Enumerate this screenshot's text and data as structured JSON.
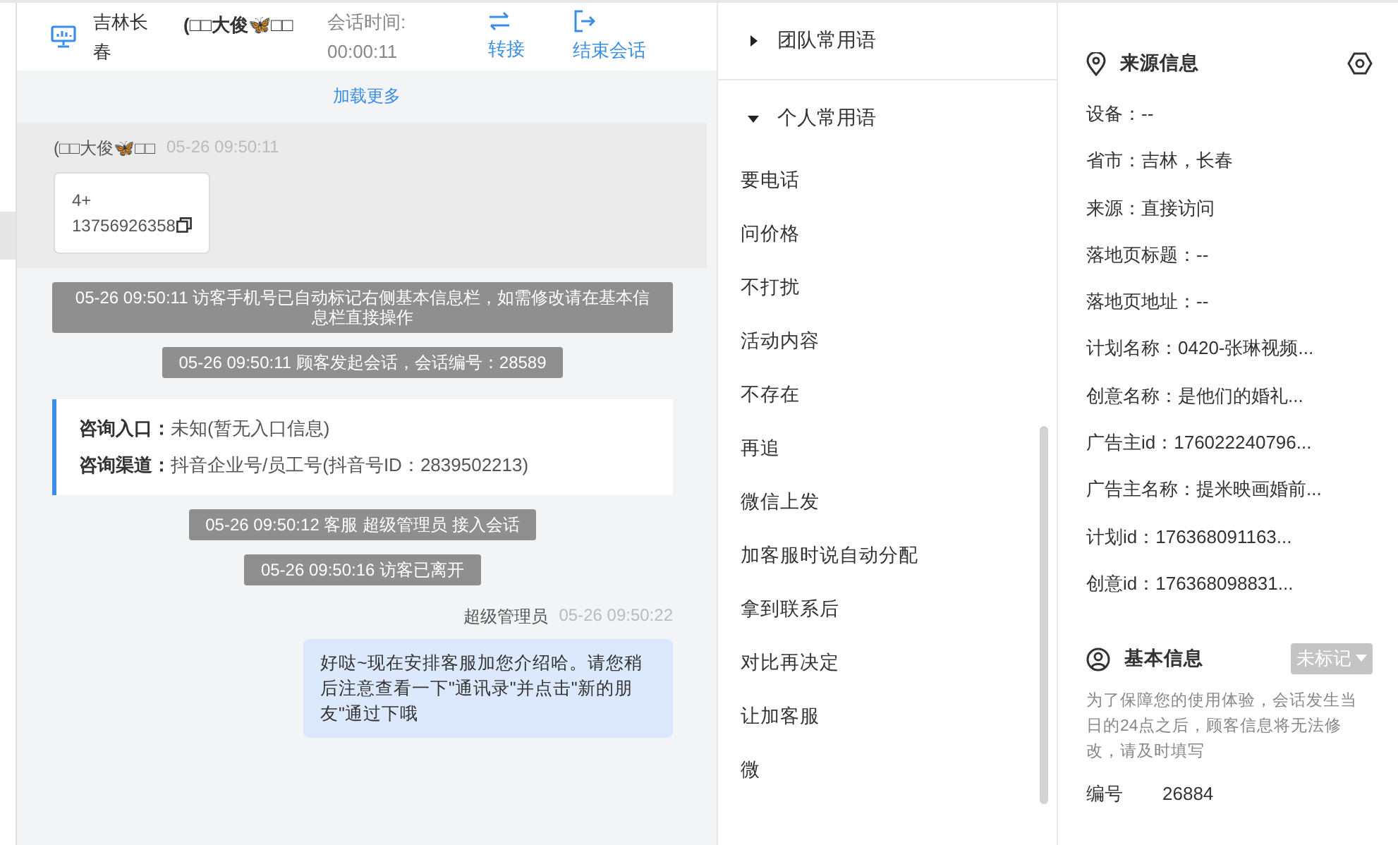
{
  "header": {
    "location": "吉林长春",
    "visitor_name": "(□□大俊🦋□□",
    "timer_label": "会话时间:",
    "timer": "00:00:11",
    "actions": [
      {
        "kind": "transfer",
        "label": "转接"
      },
      {
        "kind": "end",
        "label": "结束会话"
      }
    ]
  },
  "load_more": "加载更多",
  "messages": [
    {
      "kind": "visitor",
      "sender": "(□□大俊🦋□□",
      "time": "05-26 09:50:11",
      "lines": [
        "4+",
        "13756926358"
      ]
    },
    {
      "kind": "system",
      "text": "05-26 09:50:11 访客手机号已自动标记右侧基本信息栏，如需修改请在基本信息栏直接操作"
    },
    {
      "kind": "system",
      "text": "05-26 09:50:11 顾客发起会话，会话编号：28589"
    },
    {
      "kind": "entry",
      "rows": [
        {
          "label": "咨询入口：",
          "value": "未知(暂无入口信息)"
        },
        {
          "label": "咨询渠道：",
          "value": "抖音企业号/员工号(抖音号ID：2839502213)"
        }
      ]
    },
    {
      "kind": "system",
      "text": "05-26 09:50:12 客服 超级管理员 接入会话"
    },
    {
      "kind": "system",
      "text": "05-26 09:50:16 访客已离开"
    },
    {
      "kind": "agent",
      "sender": "超级管理员",
      "time": "05-26 09:50:22",
      "text": "好哒~现在安排客服加您介绍哈。请您稍后注意查看一下\"通讯录\"并点击\"新的朋友\"通过下哦"
    }
  ],
  "phrases": [
    {
      "title": "团队常用语",
      "expanded": false
    },
    {
      "title": "个人常用语",
      "expanded": true,
      "items": [
        "要电话",
        "问价格",
        "不打扰",
        "活动内容",
        "不存在",
        "再追",
        "微信上发",
        "加客服时说自动分配",
        "拿到联系后",
        "对比再决定",
        "让加客服",
        "微"
      ]
    }
  ],
  "source_info": {
    "title": "来源信息",
    "fields": [
      "设备：--",
      "省市：吉林，长春",
      "来源：直接访问",
      "落地页标题：--",
      "落地页地址：--",
      "计划名称：0420-张琳视频...",
      "创意名称：是他们的婚礼...",
      "广告主id：176022240796...",
      "广告主名称：提米映画婚前...",
      "计划id：176368091163...",
      "创意id：176368098831..."
    ]
  },
  "basic_info": {
    "title": "基本信息",
    "tag": "未标记",
    "note": "为了保障您的使用体验，会话发生当日的24点之后，顾客信息将无法修改，请及时填写",
    "fields": [
      {
        "label": "编号",
        "value": "26884"
      }
    ]
  }
}
